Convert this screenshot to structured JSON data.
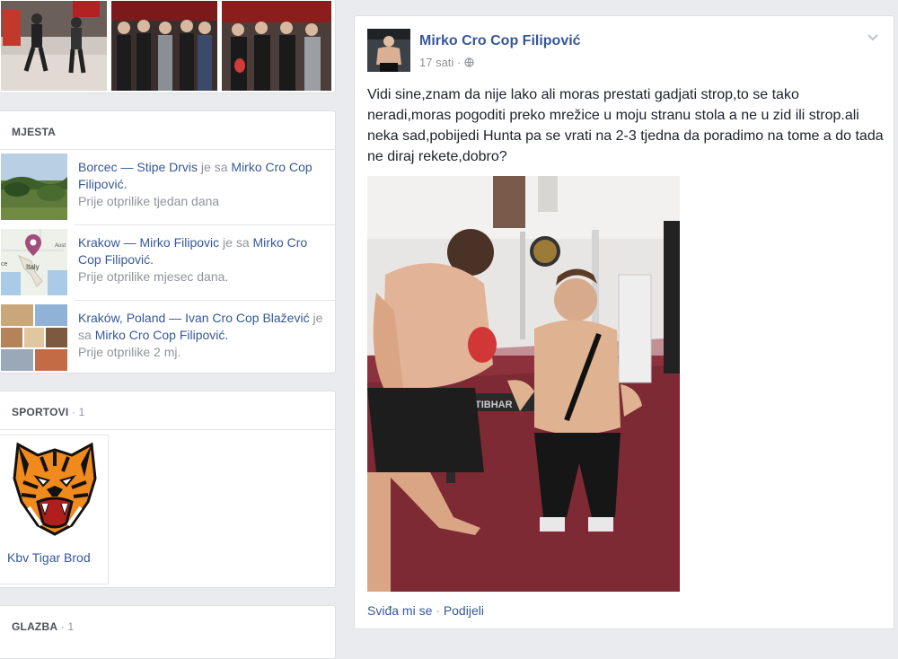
{
  "places": {
    "title": "MJESTA",
    "items": [
      {
        "place": "Borcec",
        "sep": " — ",
        "person": "Stipe Drvis",
        "with": " je sa ",
        "tagged": "Mirko Cro Cop Filipović",
        "end": ".",
        "time": "Prije otprilike tjedan dana"
      },
      {
        "place": "Krakow",
        "sep": " — ",
        "person": "Mirko Filipovic",
        "with": " je sa ",
        "tagged": "Mirko Cro Cop Filipović",
        "end": ".",
        "time": "Prije otprilike mjesec dana."
      },
      {
        "place": "Kraków, Poland",
        "sep": " — ",
        "person": "Ivan Cro Cop Blažević",
        "with": " je sa ",
        "tagged": "Mirko Cro Cop Filipović",
        "end": ".",
        "time": "Prije otprilike 2 mj."
      }
    ],
    "map_labels": {
      "country": "Italy",
      "austria": "Aust",
      "left": "ce"
    }
  },
  "sports": {
    "title": "SPORTOVI",
    "count": " · 1",
    "item_label": "Kbv Tigar Brod"
  },
  "music": {
    "title": "GLAZBA",
    "count": " · 1"
  },
  "post": {
    "author": "Mirko Cro Cop Filipović",
    "time": "17 sati",
    "time_sep": " · ",
    "text": "Vidi sine,znam da nije lako ali moras prestati gadjati strop,to se tako neradi,moras pogoditi preko mrežice u moju stranu stola a ne u zid ili strop.ali neka sad,pobijedi Hunta pa se vrati na 2-3 tjedna da poradimo na tome a do tada ne diraj rekete,dobro?",
    "table_brand": "TIBHAR",
    "actions": {
      "like": "Sviđa mi se",
      "sep": " · ",
      "share": "Podijeli"
    }
  },
  "colors": {
    "link": "#365899",
    "muted": "#90949c",
    "background": "#e9ebee"
  }
}
